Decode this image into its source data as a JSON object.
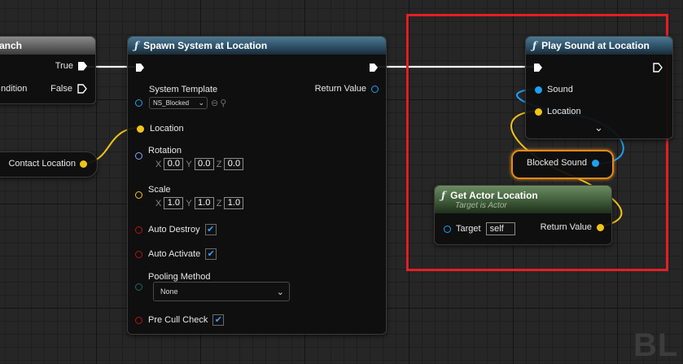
{
  "colors": {
    "exec": "#ffffff",
    "object": "#1fa0f0",
    "vector": "#f2c318",
    "rotator": "#8aa6f0",
    "bool": "#b01818",
    "enum": "#1f6b5c",
    "selection": "#e21f26"
  },
  "branch_node": {
    "title": "anch",
    "true_label": "True",
    "condition_label": "ndition",
    "false_label": "False"
  },
  "contact_node": {
    "label": "Contact Location"
  },
  "spawn_node": {
    "icon": "function-icon",
    "title": "Spawn System at Location",
    "system_template_label": "System Template",
    "system_template_value": "NS_Blocked",
    "return_value_label": "Return Value",
    "location_label": "Location",
    "rotation_label": "Rotation",
    "rotation": {
      "x_label": "X",
      "x": "0.0",
      "y_label": "Y",
      "y": "0.0",
      "z_label": "Z",
      "z": "0.0"
    },
    "scale_label": "Scale",
    "scale": {
      "x_label": "X",
      "x": "1.0",
      "y_label": "Y",
      "y": "1.0",
      "z_label": "Z",
      "z": "1.0"
    },
    "auto_destroy_label": "Auto Destroy",
    "auto_activate_label": "Auto Activate",
    "pooling_method_label": "Pooling Method",
    "pooling_method_value": "None",
    "pre_cull_check_label": "Pre Cull Check"
  },
  "play_sound_node": {
    "icon": "function-icon",
    "title": "Play Sound at Location",
    "sound_label": "Sound",
    "location_label": "Location"
  },
  "blocked_sound_node": {
    "label": "Blocked Sound"
  },
  "get_actor_node": {
    "icon": "function-icon",
    "title": "Get Actor Location",
    "subtitle": "Target is Actor",
    "target_label": "Target",
    "target_value": "self",
    "return_value_label": "Return Value"
  },
  "watermark": "BL"
}
